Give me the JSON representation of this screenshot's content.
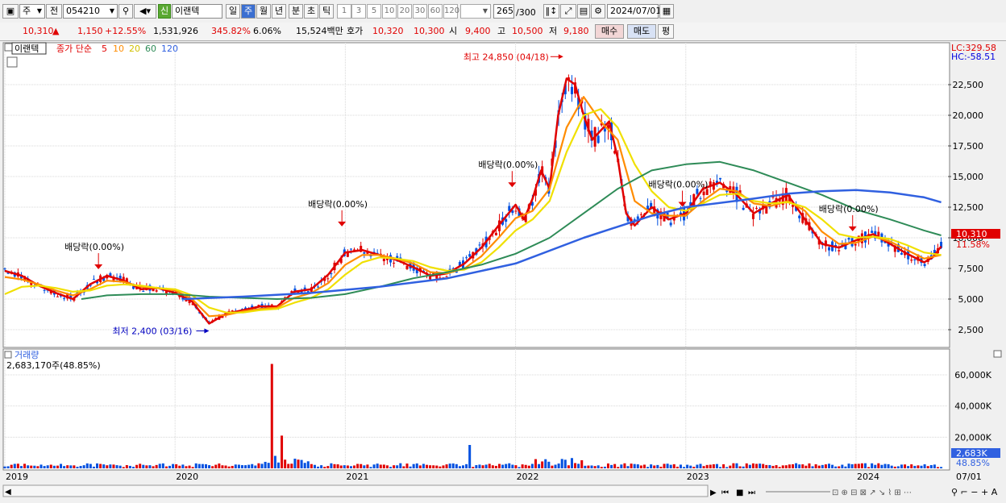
{
  "toolbar": {
    "period_type": "주",
    "prev_label": "전",
    "code": "054210",
    "badge": "신",
    "name": "이랜텍",
    "periods": [
      "일",
      "주",
      "월",
      "년",
      "분",
      "초",
      "틱"
    ],
    "selected_period": "주",
    "intervals": [
      "1",
      "3",
      "5",
      "10",
      "20",
      "30",
      "60",
      "120"
    ],
    "count": "265",
    "count_total": "/300",
    "date": "2024/07/01"
  },
  "quote": {
    "price": "10,310",
    "change": "1,150",
    "change_pct": "+12.55%",
    "volume": "1,531,926",
    "volume_ratio": "345.82%",
    "turnover": "6.06%",
    "amount": "15,524백만",
    "hoga_label": "호가",
    "ask": "10,320",
    "bid": "10,300",
    "open_label": "시",
    "open": "9,400",
    "high_label": "고",
    "high": "10,500",
    "low_label": "저",
    "low": "9,180",
    "buy_label": "매수",
    "sell_label": "매도",
    "eval_label": "평"
  },
  "price_panel": {
    "legend_name": "이랜텍",
    "legend_ma_title": "종가 단순",
    "ma_periods": [
      "5",
      "10",
      "20",
      "60",
      "120"
    ],
    "lc": "LC:329.58",
    "hc": "HC:-58.51",
    "last_price": "10,310",
    "last_pct": "11.58%"
  },
  "volume_panel": {
    "title": "거래량",
    "value": "2,683,170주(48.85%)",
    "last_volume": "2,683K",
    "last_pct": "48.85%"
  },
  "date_axis": [
    "2019",
    "2020",
    "2021",
    "2022",
    "2023",
    "2024",
    "07/01"
  ],
  "colors": {
    "up": "#e00000",
    "down": "#0050e0",
    "ma5": "#e00000",
    "ma10": "#ff8c00",
    "ma20": "#f0e000",
    "ma60": "#2e8b57",
    "ma120": "#3060e0"
  },
  "chart_data": {
    "type": "line",
    "title": "",
    "x_range": [
      "2019-01",
      "2024-07-01"
    ],
    "y_ticks": [
      2500,
      5000,
      7500,
      10000,
      12500,
      15000,
      17500,
      20000,
      22500
    ],
    "y_tick_labels": [
      "2,500",
      "5,000",
      "7,500",
      "10,000",
      "12,500",
      "15,000",
      "17,500",
      "20,000",
      "22,500"
    ],
    "vol_ticks": [
      20000,
      40000,
      60000
    ],
    "vol_tick_labels": [
      "20,000K",
      "40,000K",
      "60,000K"
    ],
    "vol_unit": "K",
    "annotations": [
      {
        "text": "최고 24,850 (04/18)",
        "x": 2022.29,
        "y": 24850
      },
      {
        "text": "최저 2,400 (03/16)",
        "x": 2020.2,
        "y": 2400
      },
      {
        "text": "배당락(0.00%)",
        "x": 2019.55,
        "y": 7300
      },
      {
        "text": "배당락(0.00%)",
        "x": 2020.98,
        "y": 10800
      },
      {
        "text": "배당락(0.00%)",
        "x": 2021.98,
        "y": 14000
      },
      {
        "text": "배당락(0.00%)",
        "x": 2022.98,
        "y": 12400
      },
      {
        "text": "배당락(0.00%)",
        "x": 2023.98,
        "y": 10400
      }
    ],
    "series": [
      {
        "name": "5",
        "points": [
          [
            2019.0,
            7300
          ],
          [
            2019.1,
            6900
          ],
          [
            2019.2,
            6100
          ],
          [
            2019.3,
            5500
          ],
          [
            2019.4,
            5000
          ],
          [
            2019.5,
            6200
          ],
          [
            2019.6,
            6900
          ],
          [
            2019.7,
            6500
          ],
          [
            2019.8,
            5800
          ],
          [
            2019.9,
            5900
          ],
          [
            2020.0,
            5500
          ],
          [
            2020.1,
            4800
          ],
          [
            2020.2,
            3000
          ],
          [
            2020.3,
            3800
          ],
          [
            2020.4,
            4100
          ],
          [
            2020.5,
            4400
          ],
          [
            2020.6,
            4400
          ],
          [
            2020.7,
            5600
          ],
          [
            2020.8,
            5800
          ],
          [
            2020.9,
            7000
          ],
          [
            2021.0,
            8800
          ],
          [
            2021.1,
            9000
          ],
          [
            2021.2,
            8600
          ],
          [
            2021.3,
            8200
          ],
          [
            2021.4,
            7600
          ],
          [
            2021.5,
            6900
          ],
          [
            2021.6,
            7100
          ],
          [
            2021.7,
            7900
          ],
          [
            2021.8,
            9200
          ],
          [
            2021.9,
            11000
          ],
          [
            2022.0,
            12700
          ],
          [
            2022.05,
            11500
          ],
          [
            2022.1,
            13200
          ],
          [
            2022.15,
            15500
          ],
          [
            2022.2,
            14000
          ],
          [
            2022.25,
            20000
          ],
          [
            2022.3,
            23000
          ],
          [
            2022.35,
            22500
          ],
          [
            2022.4,
            20000
          ],
          [
            2022.45,
            18000
          ],
          [
            2022.55,
            19500
          ],
          [
            2022.6,
            16500
          ],
          [
            2022.65,
            12000
          ],
          [
            2022.7,
            11000
          ],
          [
            2022.8,
            12500
          ],
          [
            2022.9,
            11500
          ],
          [
            2023.0,
            12000
          ],
          [
            2023.1,
            14000
          ],
          [
            2023.2,
            14500
          ],
          [
            2023.3,
            13500
          ],
          [
            2023.4,
            12000
          ],
          [
            2023.5,
            12800
          ],
          [
            2023.6,
            13500
          ],
          [
            2023.7,
            11500
          ],
          [
            2023.8,
            9500
          ],
          [
            2023.9,
            9200
          ],
          [
            2024.0,
            9800
          ],
          [
            2024.1,
            10300
          ],
          [
            2024.2,
            9500
          ],
          [
            2024.3,
            8700
          ],
          [
            2024.4,
            8000
          ],
          [
            2024.45,
            8400
          ],
          [
            2024.5,
            9300
          ]
        ]
      },
      {
        "name": "10",
        "points": [
          [
            2019.0,
            6800
          ],
          [
            2019.1,
            6600
          ],
          [
            2019.2,
            6200
          ],
          [
            2019.3,
            5700
          ],
          [
            2019.4,
            5300
          ],
          [
            2019.5,
            5800
          ],
          [
            2019.6,
            6500
          ],
          [
            2019.7,
            6400
          ],
          [
            2019.8,
            6000
          ],
          [
            2019.9,
            5900
          ],
          [
            2020.0,
            5700
          ],
          [
            2020.1,
            5000
          ],
          [
            2020.2,
            3600
          ],
          [
            2020.3,
            3700
          ],
          [
            2020.4,
            4000
          ],
          [
            2020.5,
            4200
          ],
          [
            2020.6,
            4300
          ],
          [
            2020.7,
            5100
          ],
          [
            2020.8,
            5500
          ],
          [
            2020.9,
            6300
          ],
          [
            2021.0,
            7800
          ],
          [
            2021.1,
            8600
          ],
          [
            2021.2,
            8600
          ],
          [
            2021.3,
            8300
          ],
          [
            2021.4,
            7900
          ],
          [
            2021.5,
            7200
          ],
          [
            2021.6,
            7100
          ],
          [
            2021.7,
            7500
          ],
          [
            2021.8,
            8500
          ],
          [
            2021.9,
            10000
          ],
          [
            2022.0,
            11600
          ],
          [
            2022.1,
            12200
          ],
          [
            2022.2,
            14000
          ],
          [
            2022.3,
            19000
          ],
          [
            2022.4,
            21500
          ],
          [
            2022.5,
            19500
          ],
          [
            2022.6,
            18000
          ],
          [
            2022.7,
            13000
          ],
          [
            2022.8,
            12000
          ],
          [
            2022.9,
            11800
          ],
          [
            2023.0,
            11800
          ],
          [
            2023.1,
            13000
          ],
          [
            2023.2,
            14000
          ],
          [
            2023.3,
            13800
          ],
          [
            2023.4,
            12800
          ],
          [
            2023.5,
            12600
          ],
          [
            2023.6,
            13000
          ],
          [
            2023.7,
            12200
          ],
          [
            2023.8,
            10500
          ],
          [
            2023.9,
            9500
          ],
          [
            2024.0,
            9600
          ],
          [
            2024.1,
            10100
          ],
          [
            2024.2,
            9700
          ],
          [
            2024.3,
            9000
          ],
          [
            2024.4,
            8300
          ],
          [
            2024.5,
            8600
          ]
        ]
      },
      {
        "name": "20",
        "points": [
          [
            2019.0,
            5400
          ],
          [
            2019.1,
            6000
          ],
          [
            2019.2,
            6100
          ],
          [
            2019.3,
            5900
          ],
          [
            2019.4,
            5600
          ],
          [
            2019.5,
            5700
          ],
          [
            2019.6,
            6100
          ],
          [
            2019.7,
            6200
          ],
          [
            2019.8,
            6100
          ],
          [
            2019.9,
            5900
          ],
          [
            2020.0,
            5800
          ],
          [
            2020.1,
            5300
          ],
          [
            2020.2,
            4300
          ],
          [
            2020.3,
            3900
          ],
          [
            2020.4,
            3900
          ],
          [
            2020.5,
            4100
          ],
          [
            2020.6,
            4200
          ],
          [
            2020.7,
            4700
          ],
          [
            2020.8,
            5100
          ],
          [
            2020.9,
            5800
          ],
          [
            2021.0,
            7000
          ],
          [
            2021.1,
            8000
          ],
          [
            2021.2,
            8400
          ],
          [
            2021.3,
            8300
          ],
          [
            2021.4,
            8100
          ],
          [
            2021.5,
            7600
          ],
          [
            2021.6,
            7300
          ],
          [
            2021.7,
            7400
          ],
          [
            2021.8,
            8000
          ],
          [
            2021.9,
            9200
          ],
          [
            2022.0,
            10600
          ],
          [
            2022.1,
            11500
          ],
          [
            2022.2,
            13000
          ],
          [
            2022.3,
            17000
          ],
          [
            2022.4,
            20000
          ],
          [
            2022.5,
            20500
          ],
          [
            2022.6,
            19000
          ],
          [
            2022.7,
            16000
          ],
          [
            2022.8,
            13800
          ],
          [
            2022.9,
            12500
          ],
          [
            2023.0,
            12200
          ],
          [
            2023.1,
            12800
          ],
          [
            2023.2,
            13500
          ],
          [
            2023.3,
            13600
          ],
          [
            2023.4,
            13000
          ],
          [
            2023.5,
            12800
          ],
          [
            2023.6,
            12900
          ],
          [
            2023.7,
            12500
          ],
          [
            2023.8,
            11500
          ],
          [
            2023.9,
            10300
          ],
          [
            2024.0,
            10000
          ],
          [
            2024.1,
            10100
          ],
          [
            2024.2,
            9900
          ],
          [
            2024.3,
            9400
          ],
          [
            2024.4,
            8800
          ],
          [
            2024.5,
            8600
          ]
        ]
      },
      {
        "name": "60",
        "points": [
          [
            2019.45,
            5000
          ],
          [
            2019.6,
            5300
          ],
          [
            2019.8,
            5400
          ],
          [
            2020.0,
            5400
          ],
          [
            2020.2,
            5200
          ],
          [
            2020.4,
            5100
          ],
          [
            2020.6,
            5000
          ],
          [
            2020.8,
            5100
          ],
          [
            2021.0,
            5400
          ],
          [
            2021.2,
            6000
          ],
          [
            2021.4,
            6700
          ],
          [
            2021.6,
            7200
          ],
          [
            2021.8,
            7800
          ],
          [
            2022.0,
            8700
          ],
          [
            2022.2,
            10000
          ],
          [
            2022.4,
            12000
          ],
          [
            2022.6,
            14000
          ],
          [
            2022.8,
            15500
          ],
          [
            2023.0,
            16000
          ],
          [
            2023.2,
            16200
          ],
          [
            2023.4,
            15500
          ],
          [
            2023.6,
            14500
          ],
          [
            2023.8,
            13500
          ],
          [
            2024.0,
            12300
          ],
          [
            2024.2,
            11500
          ],
          [
            2024.4,
            10600
          ],
          [
            2024.5,
            10200
          ]
        ]
      },
      {
        "name": "120",
        "points": [
          [
            2020.05,
            5000
          ],
          [
            2020.4,
            5200
          ],
          [
            2020.8,
            5500
          ],
          [
            2021.2,
            6000
          ],
          [
            2021.6,
            6700
          ],
          [
            2022.0,
            7900
          ],
          [
            2022.4,
            10000
          ],
          [
            2022.8,
            11800
          ],
          [
            2023.0,
            12500
          ],
          [
            2023.4,
            13200
          ],
          [
            2023.6,
            13600
          ],
          [
            2023.8,
            13800
          ],
          [
            2024.0,
            13900
          ],
          [
            2024.2,
            13700
          ],
          [
            2024.4,
            13300
          ],
          [
            2024.5,
            12900
          ]
        ]
      }
    ]
  }
}
